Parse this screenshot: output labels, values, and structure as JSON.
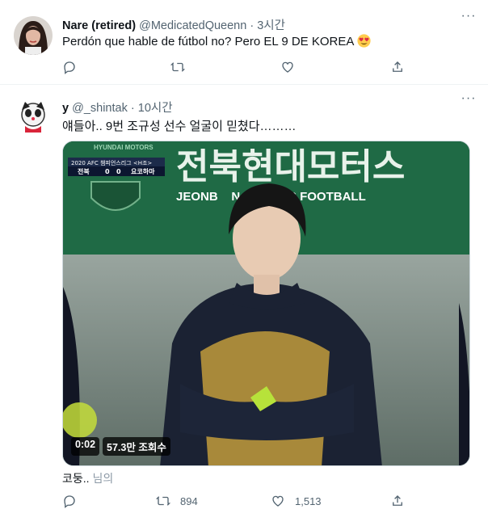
{
  "tweet1": {
    "name": "Nare (retired)",
    "handle": "@MedicatedQueenn",
    "dot": "·",
    "time": "3시간",
    "text": "Perdón que hable de fútbol no? Pero EL 9 DE KOREA",
    "emoji": "smiling-face-with-heart-eyes",
    "more": "···",
    "actions": {
      "reply_icon": "reply-icon",
      "retweet_icon": "retweet-icon",
      "like_icon": "like-icon",
      "share_icon": "share-icon"
    }
  },
  "tweet2": {
    "name": "y",
    "handle": "@_shintak",
    "dot": "·",
    "time": "10시간",
    "text": "얘들아.. 9번 조규성 선수 얼굴이 믿쳤다………",
    "more": "···",
    "media": {
      "type": "video",
      "duration": "0:02",
      "views": "57.3만 조회수",
      "scoreboard": {
        "title": "2020 AFC 챔피언스리그 <H조>",
        "team1": "전북",
        "score1": "0",
        "score2": "0",
        "team2": "요코하마"
      },
      "banner_top": "전북현대모터스",
      "banner_bottom": "JEONB    N MOTORS FOOTBALL",
      "sponsor": "HYUNDAI MOTORS"
    },
    "caption": "코둥..",
    "caption_suffix": "님의",
    "counts": {
      "retweets": "894",
      "likes": "1,513"
    }
  },
  "colors": {
    "text": "#0f1419",
    "secondary": "#536471",
    "border": "#eff3f4"
  }
}
